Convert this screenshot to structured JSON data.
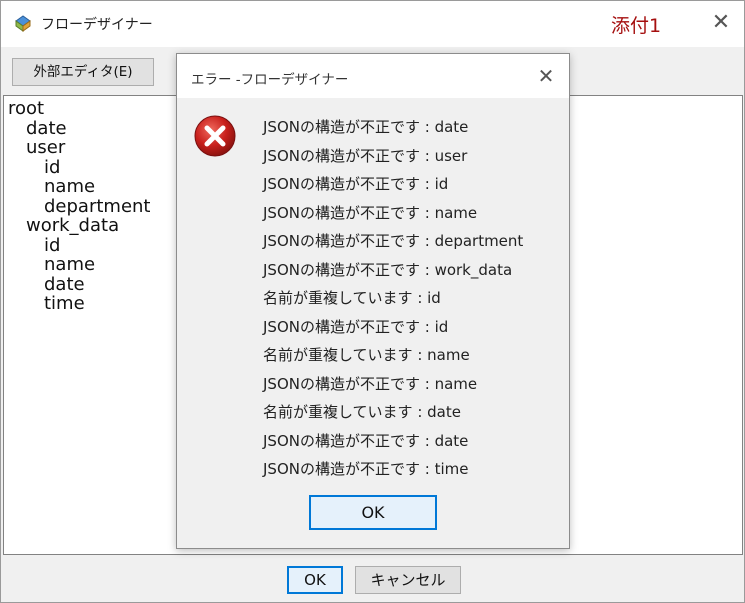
{
  "window": {
    "title": "フローデザイナー",
    "attachment_label": "添付1",
    "close_glyph": "✕"
  },
  "toolbar": {
    "external_editor_label": "外部エディタ(E)"
  },
  "tree": {
    "nodes": [
      {
        "label": "root",
        "depth": 0
      },
      {
        "label": "date",
        "depth": 1
      },
      {
        "label": "user",
        "depth": 1
      },
      {
        "label": "id",
        "depth": 2
      },
      {
        "label": "name",
        "depth": 2
      },
      {
        "label": "department",
        "depth": 2
      },
      {
        "label": "work_data",
        "depth": 1
      },
      {
        "label": "id",
        "depth": 2
      },
      {
        "label": "name",
        "depth": 2
      },
      {
        "label": "date",
        "depth": 2
      },
      {
        "label": "time",
        "depth": 2
      }
    ]
  },
  "bottom_buttons": {
    "ok_label": "OK",
    "cancel_label": "キャンセル"
  },
  "error_dialog": {
    "title": "エラー -フローデザイナー",
    "close_glyph": "✕",
    "icon": "error-icon",
    "messages": [
      "JSONの構造が不正です : date",
      "JSONの構造が不正です : user",
      "JSONの構造が不正です : id",
      "JSONの構造が不正です : name",
      "JSONの構造が不正です : department",
      "JSONの構造が不正です : work_data",
      "名前が重複しています : id",
      "JSONの構造が不正です : id",
      "名前が重複しています : name",
      "JSONの構造が不正です : name",
      "名前が重複しています : date",
      "JSONの構造が不正です : date",
      "JSONの構造が不正です : time"
    ],
    "ok_label": "OK"
  },
  "colors": {
    "accent": "#0078d7",
    "attachment_red": "#a50f0f",
    "error_red": "#c8201c"
  }
}
